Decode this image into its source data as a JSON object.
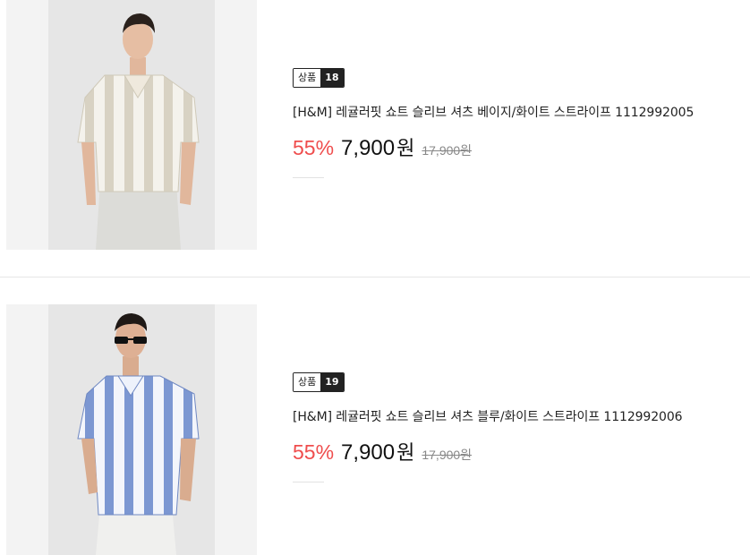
{
  "products": [
    {
      "badge_label": "상품",
      "badge_number": "18",
      "name": "[H&M] 레귤러핏 쇼트 슬리브 셔츠 베이지/화이트 스트라이프 1112992005",
      "discount": "55%",
      "price": "7,900",
      "currency": "원",
      "original_price": "17,900원",
      "stripe_color": "#d8d2c3",
      "image_subject": "model-beige-stripe-shirt"
    },
    {
      "badge_label": "상품",
      "badge_number": "19",
      "name": "[H&M] 레귤러핏 쇼트 슬리브 셔츠 블루/화이트 스트라이프 1112992006",
      "discount": "55%",
      "price": "7,900",
      "currency": "원",
      "original_price": "17,900원",
      "stripe_color": "#7c97d2",
      "image_subject": "model-blue-stripe-shirt"
    }
  ],
  "colors": {
    "discount": "#ef4d4d",
    "badge_bg": "#222222"
  }
}
